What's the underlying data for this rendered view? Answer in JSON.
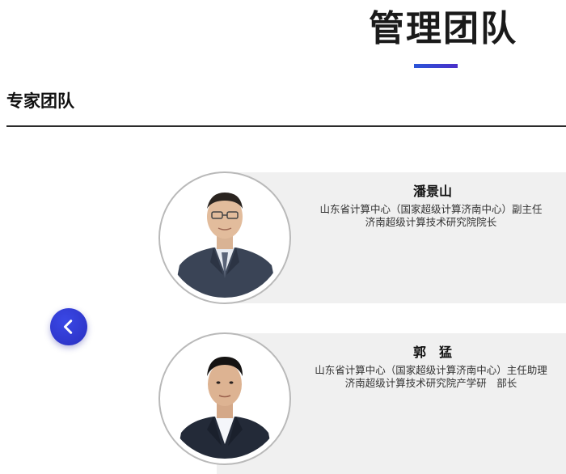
{
  "page": {
    "title": "管理团队"
  },
  "section": {
    "title": "专家团队"
  },
  "carousel": {
    "prev_icon": "chevron-left-icon",
    "accent": "#2f3bd6"
  },
  "members": [
    {
      "name": "潘景山",
      "lines": [
        "山东省计算中心（国家超级计算济南中心）副主任",
        "济南超级计算技术研究院院长"
      ],
      "avatar_icon": "person-portrait-icon"
    },
    {
      "name": "郭　猛",
      "lines": [
        "山东省计算中心（国家超级计算济南中心）主任助理",
        "济南超级计算技术研究院产学研　部长"
      ],
      "avatar_icon": "person-portrait-icon"
    }
  ]
}
